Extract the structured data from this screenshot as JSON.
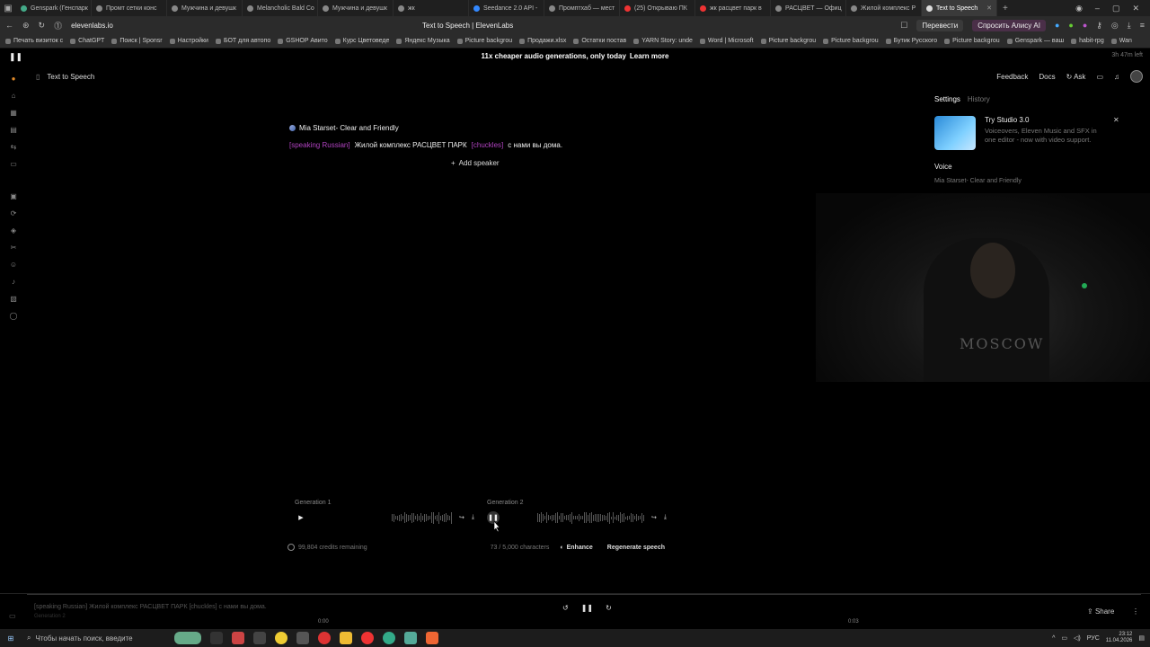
{
  "browser": {
    "tabs": [
      {
        "label": "Genspark (Генспарк",
        "color": "#4a8"
      },
      {
        "label": "Промт сетки конс",
        "color": "#888"
      },
      {
        "label": "Мужчина и девушк",
        "color": "#888"
      },
      {
        "label": "Melancholic Bald Co",
        "color": "#888"
      },
      {
        "label": "Мужчина и девушк",
        "color": "#888"
      },
      {
        "label": "жк",
        "color": "#888"
      },
      {
        "label": "Seedance 2.0 API -",
        "color": "#38f"
      },
      {
        "label": "Промптхаб — мест",
        "color": "#888"
      },
      {
        "label": "(25) Открываю ПК",
        "color": "#e33"
      },
      {
        "label": "жк расцвет парк в",
        "color": "#e33"
      },
      {
        "label": "РАСЦВЕТ — Офиц",
        "color": "#888"
      },
      {
        "label": "Жилой комплекс Р",
        "color": "#888"
      },
      {
        "label": "Text to Speech",
        "color": "#ddd",
        "active": true
      }
    ],
    "url": "elevenlabs.io",
    "page_title": "Text to Speech | ElevenLabs",
    "translate_label": "Перевести",
    "alisa_label": "Спросить Алису AI",
    "bookmarks": [
      "Печать визиток с",
      "ChatGPT",
      "Поиск | Sponsr",
      "Настройки",
      "БОТ для автопо",
      "GSHOP Авито",
      "Курс Цветоведе",
      "Яндекс Музыка",
      "Picture backgrou",
      "Продажи.xlsx",
      "Остатки постав",
      "YARN Story: unde",
      "Word | Microsoft",
      "Picture backgrou",
      "Picture backgrou",
      "Бутик Русского",
      "Picture backgrou",
      "Genspark — ваш",
      "habit-rpg",
      "Wan"
    ]
  },
  "app": {
    "promo_text": "11x cheaper audio generations, only today",
    "promo_link": "Learn more",
    "time_left": "3h 47m left",
    "section_title": "Text to Speech",
    "nav_right": {
      "feedback": "Feedback",
      "docs": "Docs",
      "ask": "Ask"
    },
    "speaker_name": "Mia Starset- Clear and Friendly",
    "script": {
      "tag1": "[speaking Russian]",
      "text1": "Жилой комплекс РАСЦВЕТ ПАРК",
      "tag2": "[chuckles]",
      "text2": "с нами вы дома."
    },
    "add_speaker": "Add speaker",
    "right_panel": {
      "tab_settings": "Settings",
      "tab_history": "History",
      "card_title": "Try Studio 3.0",
      "card_desc": "Voiceovers, Eleven Music and SFX in one editor - now with video support.",
      "voice_label": "Voice",
      "voice_value": "Mia Starset- Clear and Friendly"
    },
    "generations": [
      {
        "label": "Generation 1"
      },
      {
        "label": "Generation 2"
      }
    ],
    "credits": "99,804 credits remaining",
    "chars": "73 / 5,000 characters",
    "enhance": "Enhance",
    "regenerate": "Regenerate speech",
    "webcam_shirt": "MOSCOW"
  },
  "player": {
    "text": "[speaking Russian] Жилой комплекс РАСЦВЕТ ПАРК [chuckles] с нами вы дома.",
    "subtext": "Generation 2",
    "time_start": "0:00",
    "time_end": "0:03",
    "share": "Share"
  },
  "taskbar": {
    "search_placeholder": "Чтобы начать поиск, введите",
    "lang": "РУС",
    "time": "23:12",
    "date": "11.04.2026"
  }
}
